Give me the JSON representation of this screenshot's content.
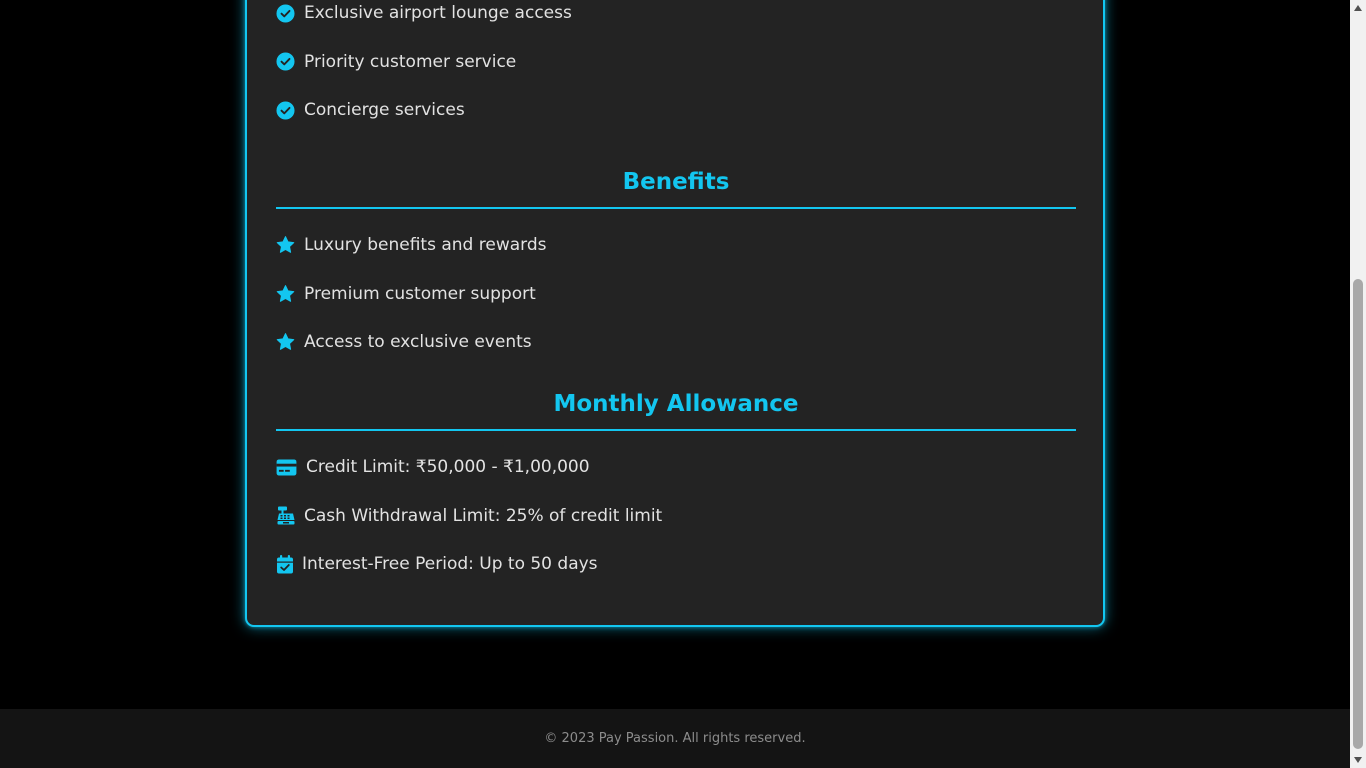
{
  "features": {
    "items": [
      {
        "icon": "check-circle-icon",
        "label": "Exclusive airport lounge access"
      },
      {
        "icon": "check-circle-icon",
        "label": "Priority customer service"
      },
      {
        "icon": "check-circle-icon",
        "label": "Concierge services"
      }
    ]
  },
  "benefits": {
    "title": "Benefits",
    "items": [
      {
        "icon": "star-icon",
        "label": "Luxury benefits and rewards"
      },
      {
        "icon": "star-icon",
        "label": "Premium customer support"
      },
      {
        "icon": "star-icon",
        "label": "Access to exclusive events"
      }
    ]
  },
  "allowance": {
    "title": "Monthly Allowance",
    "items": [
      {
        "icon": "credit-card-icon",
        "label": "Credit Limit: ₹50,000 - ₹1,00,000"
      },
      {
        "icon": "cash-register-icon",
        "label": "Cash Withdrawal Limit: 25% of credit limit"
      },
      {
        "icon": "calendar-check-icon",
        "label": "Interest-Free Period: Up to 50 days"
      }
    ]
  },
  "footer": {
    "text": "© 2023 Pay Passion. All rights reserved."
  },
  "colors": {
    "accent": "#13c6f0",
    "card_bg": "#232323",
    "page_bg": "#000000",
    "text": "#e2e2e2",
    "footer_bg": "#141414",
    "footer_text": "#8c8c8c"
  }
}
